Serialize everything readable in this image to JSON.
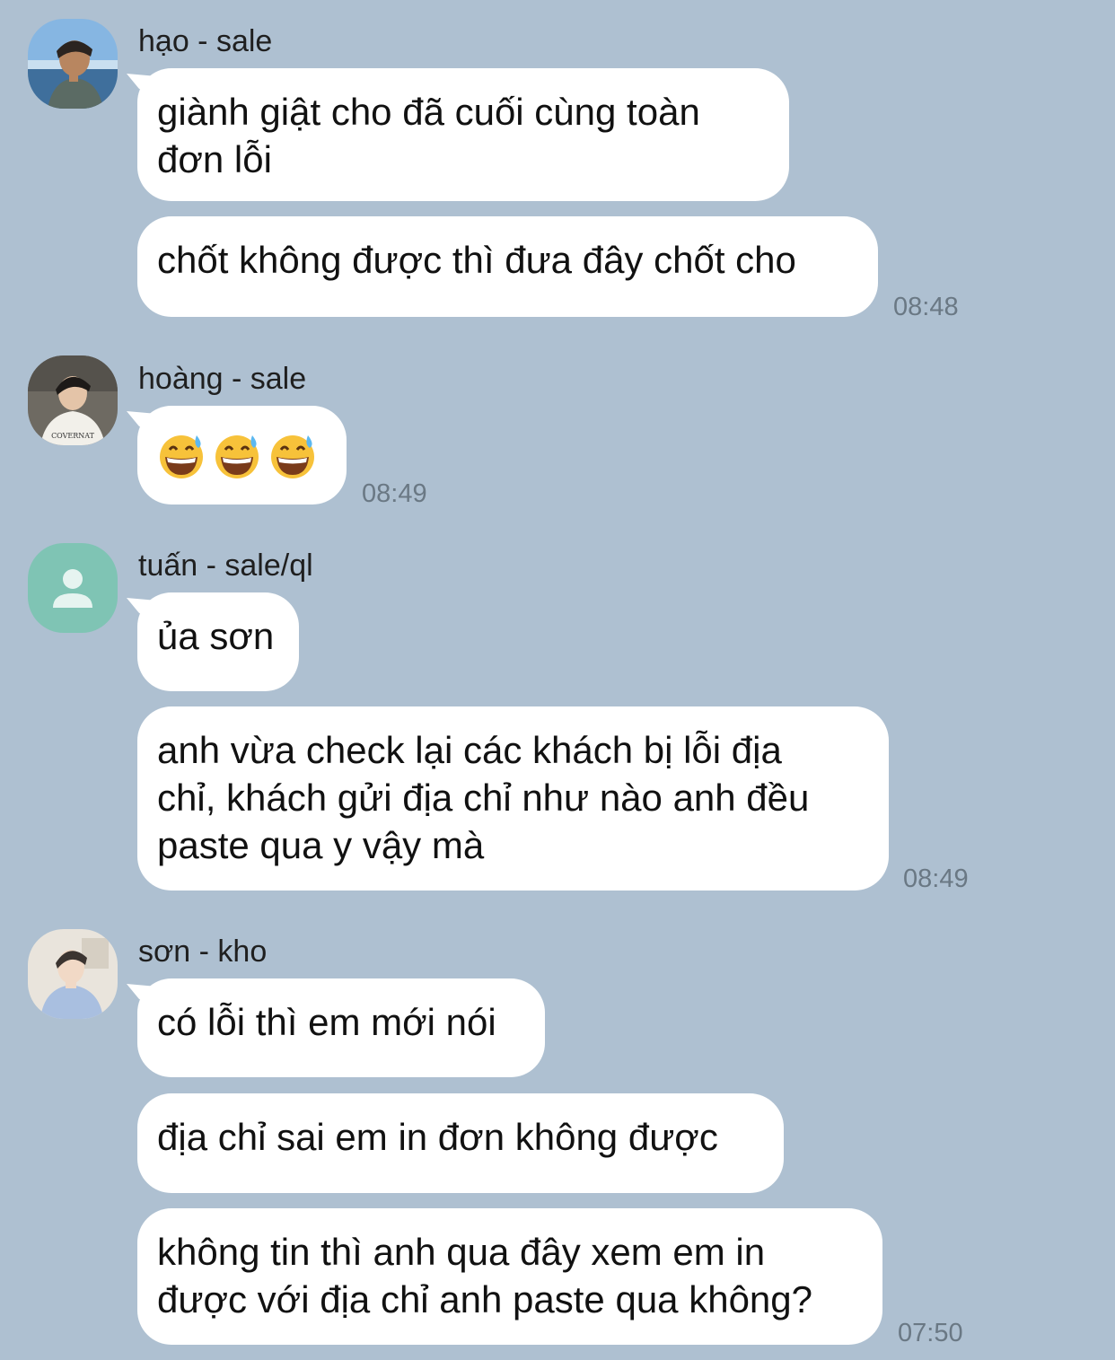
{
  "messages": [
    {
      "sender": "hạo - sale",
      "avatar": "avatar-hao",
      "bubbles": [
        {
          "lines": [
            "giành giật cho đã cuối cùng toàn",
            "đơn lỗi"
          ]
        },
        {
          "lines": [
            "chốt không được thì đưa đây chốt cho"
          ],
          "time": "08:48"
        }
      ]
    },
    {
      "sender": "hoàng - sale",
      "avatar": "avatar-hoang",
      "bubbles": [
        {
          "emoji": [
            "grinning-sweat-emoji",
            "grinning-sweat-emoji",
            "grinning-sweat-emoji"
          ],
          "time": "08:49"
        }
      ]
    },
    {
      "sender": "tuấn - sale/ql",
      "avatar": "default-person-icon",
      "bubbles": [
        {
          "lines": [
            "ủa sơn"
          ]
        },
        {
          "lines": [
            "anh vừa check lại các khách bị lỗi địa",
            "chỉ, khách gửi địa chỉ như nào anh đều",
            "paste qua y vậy mà"
          ],
          "time": "08:49"
        }
      ]
    },
    {
      "sender": "sơn - kho",
      "avatar": "avatar-son",
      "bubbles": [
        {
          "lines": [
            "có lỗi thì em mới nói"
          ]
        },
        {
          "lines": [
            "địa chỉ sai em in đơn không được"
          ]
        },
        {
          "lines": [
            "không tin thì anh qua đây xem em in",
            "được với địa chỉ anh paste qua không?"
          ],
          "time": "07:50"
        }
      ]
    }
  ]
}
